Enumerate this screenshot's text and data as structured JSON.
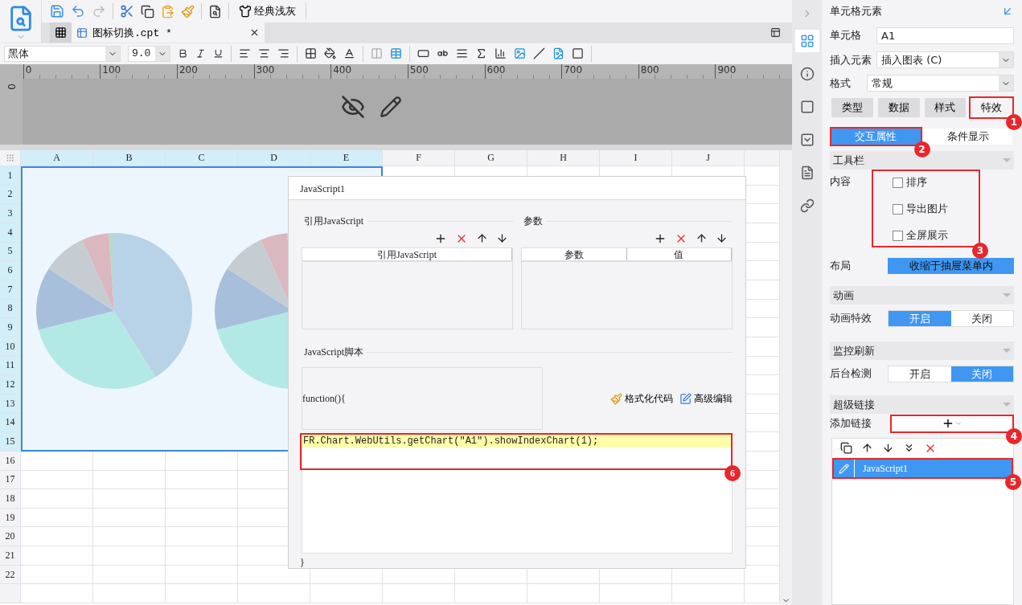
{
  "toolbar": {
    "theme_button": "经典浅灰"
  },
  "tabs": [
    {
      "label": "图标切换.cpt *",
      "selected": true
    }
  ],
  "format_bar": {
    "font": "黑体",
    "size": "9.0"
  },
  "ruler": {
    "vertical": "0",
    "ticks": [
      "0",
      "100",
      "200",
      "300",
      "400",
      "500",
      "600",
      "700",
      "800",
      "900"
    ]
  },
  "sheet": {
    "columns": [
      {
        "label": "A",
        "selected": true
      },
      {
        "label": "B",
        "selected": true
      },
      {
        "label": "C",
        "selected": true
      },
      {
        "label": "D",
        "selected": true
      },
      {
        "label": "E",
        "selected": true
      },
      {
        "label": "F",
        "selected": false
      },
      {
        "label": "G",
        "selected": false
      },
      {
        "label": "H",
        "selected": false
      },
      {
        "label": "I",
        "selected": false
      },
      {
        "label": "J",
        "selected": false
      }
    ],
    "rows": [
      {
        "label": "1",
        "selected": true
      },
      {
        "label": "2",
        "selected": true
      },
      {
        "label": "3",
        "selected": true
      },
      {
        "label": "4",
        "selected": true
      },
      {
        "label": "5",
        "selected": true
      },
      {
        "label": "6",
        "selected": true
      },
      {
        "label": "7",
        "selected": true
      },
      {
        "label": "8",
        "selected": true
      },
      {
        "label": "9",
        "selected": true
      },
      {
        "label": "10",
        "selected": true
      },
      {
        "label": "11",
        "selected": true
      },
      {
        "label": "12",
        "selected": true
      },
      {
        "label": "13",
        "selected": true
      },
      {
        "label": "14",
        "selected": true
      },
      {
        "label": "15",
        "selected": true
      },
      {
        "label": "16",
        "selected": false
      },
      {
        "label": "17",
        "selected": false
      },
      {
        "label": "18",
        "selected": false
      },
      {
        "label": "19",
        "selected": false
      },
      {
        "label": "20",
        "selected": false
      },
      {
        "label": "21",
        "selected": false
      },
      {
        "label": "22",
        "selected": false
      }
    ]
  },
  "dialog": {
    "title": "JavaScript1",
    "import_section": {
      "title": "引用JavaScript",
      "columns": [
        "引用JavaScript"
      ]
    },
    "params_section": {
      "title": "参数",
      "columns": [
        "参数",
        "值"
      ]
    },
    "script_section": {
      "title": "JavaScript脚本",
      "header": "function(){",
      "format_button": "格式化代码",
      "advanced_button": "高级编辑",
      "code": "FR.Chart.WebUtils.getChart(\"A1\").showIndexChart(1);",
      "code_callout": "6",
      "footer": "}"
    }
  },
  "panel": {
    "title": "单元格元素",
    "cell": {
      "label": "单元格",
      "value": "A1"
    },
    "insert": {
      "label": "插入元素",
      "value": "插入图表 (C)"
    },
    "format": {
      "label": "格式",
      "value": "常规"
    },
    "tabs": [
      {
        "label": "类型",
        "selected": false
      },
      {
        "label": "数据",
        "selected": false
      },
      {
        "label": "样式",
        "selected": false
      },
      {
        "label": "特效",
        "selected": true,
        "callout": "1"
      }
    ],
    "subtabs": [
      {
        "label": "交互属性",
        "selected": true,
        "callout": "2"
      },
      {
        "label": "条件显示",
        "selected": false
      }
    ],
    "toolbar_section": {
      "title": "工具栏",
      "content_label": "内容",
      "options_callout": "3",
      "options": [
        {
          "label": "排序",
          "checked": false
        },
        {
          "label": "导出图片",
          "checked": false
        },
        {
          "label": "全屏展示",
          "checked": false
        }
      ],
      "layout_label": "布局",
      "layout_value": "收缩于抽屉菜单内"
    },
    "animation_section": {
      "title": "动画",
      "label": "动画特效",
      "options": [
        {
          "label": "开启",
          "selected": true
        },
        {
          "label": "关闭",
          "selected": false
        }
      ]
    },
    "refresh_section": {
      "title": "监控刷新",
      "label": "后台检测",
      "options": [
        {
          "label": "开启",
          "selected": false
        },
        {
          "label": "关闭",
          "selected": true
        }
      ]
    },
    "link_section": {
      "title": "超级链接",
      "label": "添加链接",
      "add_callout": "4",
      "items": [
        {
          "label": "JavaScript1",
          "selected": true,
          "callout": "5"
        }
      ]
    }
  }
}
